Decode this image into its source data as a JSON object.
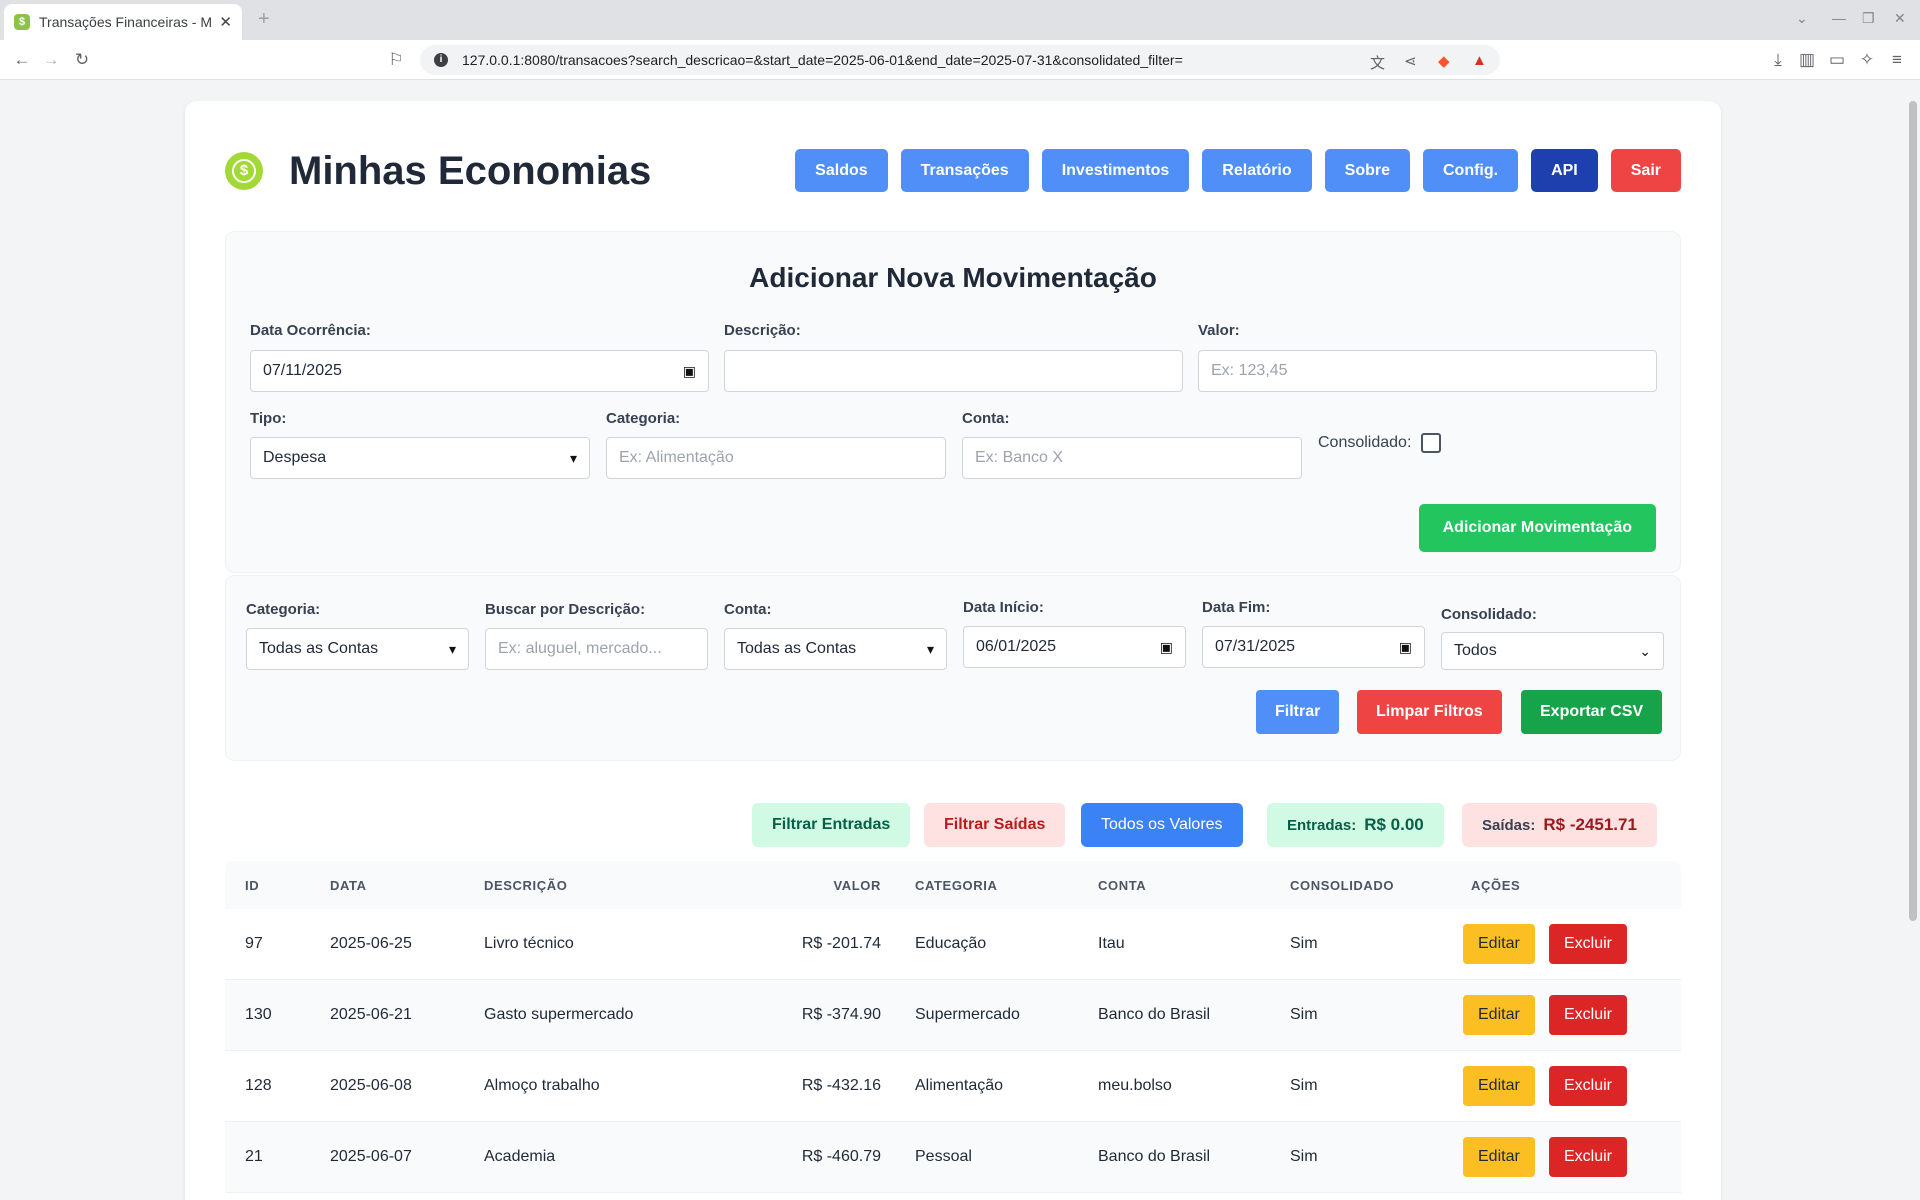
{
  "browser": {
    "tab_title": "Transações Financeiras - Min",
    "url": "127.0.0.1:8080/transacoes?search_descricao=&start_date=2025-06-01&end_date=2025-07-31&consolidated_filter="
  },
  "app": {
    "title": "Minhas Economias",
    "nav": [
      "Saldos",
      "Transações",
      "Investimentos",
      "Relatório",
      "Sobre",
      "Config.",
      "API",
      "Sair"
    ]
  },
  "form": {
    "title": "Adicionar Nova Movimentação",
    "data_label": "Data Ocorrência:",
    "data_value": "07/11/2025",
    "descricao_label": "Descrição:",
    "descricao_value": "",
    "valor_label": "Valor:",
    "valor_placeholder": "Ex: 123,45",
    "tipo_label": "Tipo:",
    "tipo_value": "Despesa",
    "categoria_label": "Categoria:",
    "categoria_placeholder": "Ex: Alimentação",
    "conta_label": "Conta:",
    "conta_placeholder": "Ex: Banco X",
    "consolidado_label": "Consolidado:",
    "submit": "Adicionar Movimentação"
  },
  "filters": {
    "categoria_label": "Categoria:",
    "categoria_value": "Todas as Contas",
    "busca_label": "Buscar por Descrição:",
    "busca_placeholder": "Ex: aluguel, mercado...",
    "conta_label": "Conta:",
    "conta_value": "Todas as Contas",
    "inicio_label": "Data Início:",
    "inicio_value": "06/01/2025",
    "fim_label": "Data Fim:",
    "fim_value": "07/31/2025",
    "consolidado_label": "Consolidado:",
    "consolidado_value": "Todos",
    "filtrar": "Filtrar",
    "limpar": "Limpar Filtros",
    "exportar": "Exportar CSV"
  },
  "summary": {
    "filtrar_entradas": "Filtrar Entradas",
    "filtrar_saidas": "Filtrar Saídas",
    "todos_valores": "Todos os Valores",
    "entradas_label": "Entradas:",
    "entradas_value": "R$ 0.00",
    "saidas_label": "Saídas:",
    "saidas_value": "R$ -2451.71"
  },
  "table": {
    "headers": [
      "ID",
      "DATA",
      "DESCRIÇÃO",
      "VALOR",
      "CATEGORIA",
      "CONTA",
      "CONSOLIDADO",
      "AÇÕES"
    ],
    "edit_label": "Editar",
    "delete_label": "Excluir",
    "rows": [
      [
        "97",
        "2025-06-25",
        "Livro técnico",
        "R$ -201.74",
        "Educação",
        "Itau",
        "Sim"
      ],
      [
        "130",
        "2025-06-21",
        "Gasto supermercado",
        "R$ -374.90",
        "Supermercado",
        "Banco do Brasil",
        "Sim"
      ],
      [
        "128",
        "2025-06-08",
        "Almoço trabalho",
        "R$ -432.16",
        "Alimentação",
        "meu.bolso",
        "Sim"
      ],
      [
        "21",
        "2025-06-07",
        "Academia",
        "R$ -460.79",
        "Pessoal",
        "Banco do Brasil",
        "Sim"
      ]
    ]
  },
  "colors": {
    "primary": "#4f8ff7",
    "api": "#1e40af",
    "danger": "#ef4444",
    "success": "#22c55e",
    "warning": "#fbbf24"
  }
}
